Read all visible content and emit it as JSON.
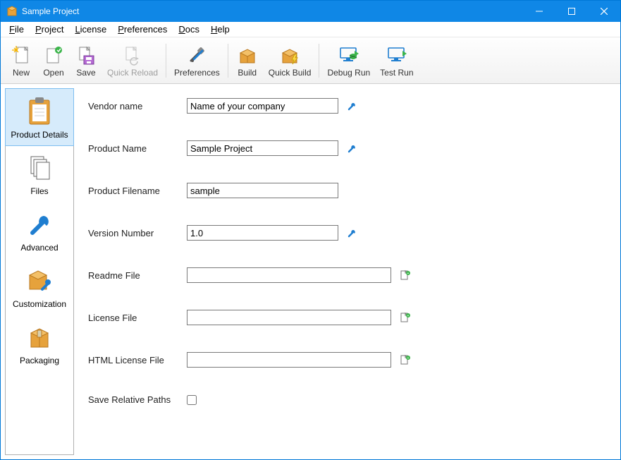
{
  "window": {
    "title": "Sample Project"
  },
  "menu": {
    "file": "File",
    "project": "Project",
    "license": "License",
    "preferences": "Preferences",
    "docs": "Docs",
    "help": "Help"
  },
  "toolbar": {
    "new": "New",
    "open": "Open",
    "save": "Save",
    "quick_reload": "Quick Reload",
    "preferences": "Preferences",
    "build": "Build",
    "quick_build": "Quick Build",
    "debug_run": "Debug Run",
    "test_run": "Test Run"
  },
  "sidenav": {
    "product_details": "Product Details",
    "files": "Files",
    "advanced": "Advanced",
    "customization": "Customization",
    "packaging": "Packaging"
  },
  "form": {
    "vendor_name_label": "Vendor name",
    "vendor_name_value": "Name of your company",
    "product_name_label": "Product Name",
    "product_name_value": "Sample Project",
    "product_filename_label": "Product Filename",
    "product_filename_value": "sample",
    "version_label": "Version Number",
    "version_value": "1.0",
    "readme_label": "Readme File",
    "readme_value": "",
    "license_label": "License File",
    "license_value": "",
    "html_license_label": "HTML License File",
    "html_license_value": "",
    "save_relative_label": "Save Relative Paths"
  }
}
